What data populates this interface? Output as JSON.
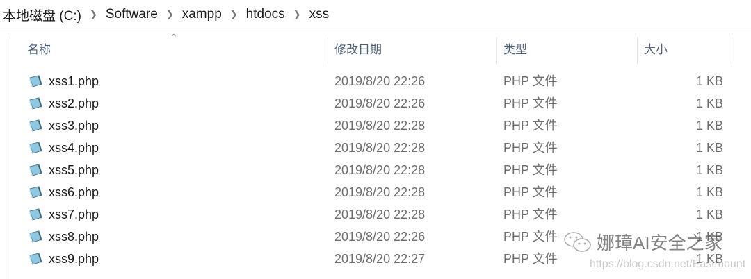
{
  "breadcrumb": [
    "本地磁盘 (C:)",
    "Software",
    "xampp",
    "htdocs",
    "xss"
  ],
  "columns": {
    "name": "名称",
    "date": "修改日期",
    "type": "类型",
    "size": "大小"
  },
  "files": [
    {
      "name": "xss1.php",
      "date": "2019/8/20 22:26",
      "type": "PHP 文件",
      "size": "1 KB"
    },
    {
      "name": "xss2.php",
      "date": "2019/8/20 22:26",
      "type": "PHP 文件",
      "size": "1 KB"
    },
    {
      "name": "xss3.php",
      "date": "2019/8/20 22:28",
      "type": "PHP 文件",
      "size": "1 KB"
    },
    {
      "name": "xss4.php",
      "date": "2019/8/20 22:28",
      "type": "PHP 文件",
      "size": "1 KB"
    },
    {
      "name": "xss5.php",
      "date": "2019/8/20 22:28",
      "type": "PHP 文件",
      "size": "1 KB"
    },
    {
      "name": "xss6.php",
      "date": "2019/8/20 22:28",
      "type": "PHP 文件",
      "size": "1 KB"
    },
    {
      "name": "xss7.php",
      "date": "2019/8/20 22:28",
      "type": "PHP 文件",
      "size": "1 KB"
    },
    {
      "name": "xss8.php",
      "date": "2019/8/20 22:26",
      "type": "PHP 文件",
      "size": "1 KB"
    },
    {
      "name": "xss9.php",
      "date": "2019/8/20 22:27",
      "type": "PHP 文件",
      "size": "1 KB"
    }
  ],
  "watermark": {
    "brand": "娜璋AI安全之家",
    "url": "https://blog.csdn.net/Eastmount"
  }
}
